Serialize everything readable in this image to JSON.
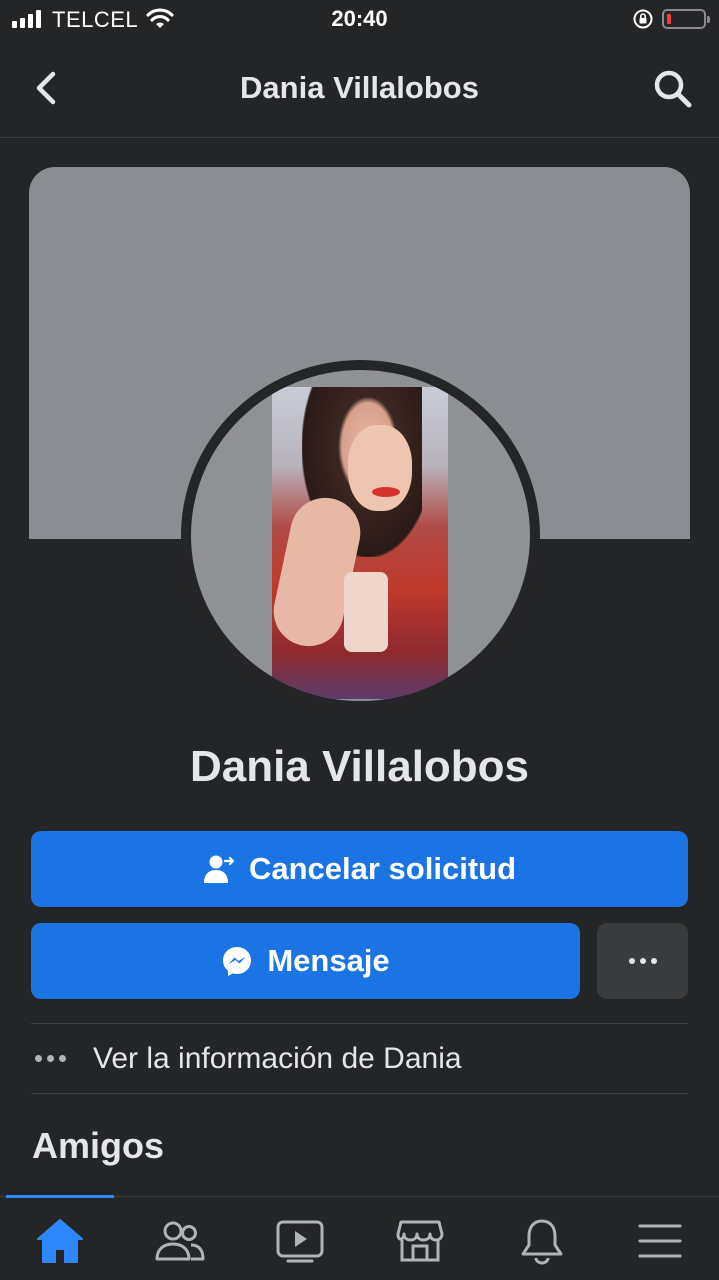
{
  "status_bar": {
    "carrier": "TELCEL",
    "time": "20:40",
    "icons": [
      "signal-icon",
      "wifi-icon",
      "rotation-lock-icon",
      "battery-icon"
    ],
    "battery_color": "#ff3b30"
  },
  "header": {
    "title": "Dania Villalobos",
    "back_icon": "chevron-left-icon",
    "search_icon": "search-icon"
  },
  "profile": {
    "name": "Dania Villalobos",
    "cover_color": "#8a8d91"
  },
  "actions": {
    "cancel_request_label": "Cancelar solicitud",
    "message_label": "Mensaje",
    "more_icon": "more-dots-icon",
    "accent": "#1b74e4"
  },
  "info": {
    "label": "Ver la información de Dania"
  },
  "friends": {
    "title": "Amigos"
  },
  "bottom_nav": {
    "items": [
      "home-icon",
      "friends-icon",
      "watch-icon",
      "marketplace-icon",
      "notifications-icon",
      "menu-icon"
    ],
    "active": "home-icon",
    "active_color": "#2d88ff"
  }
}
